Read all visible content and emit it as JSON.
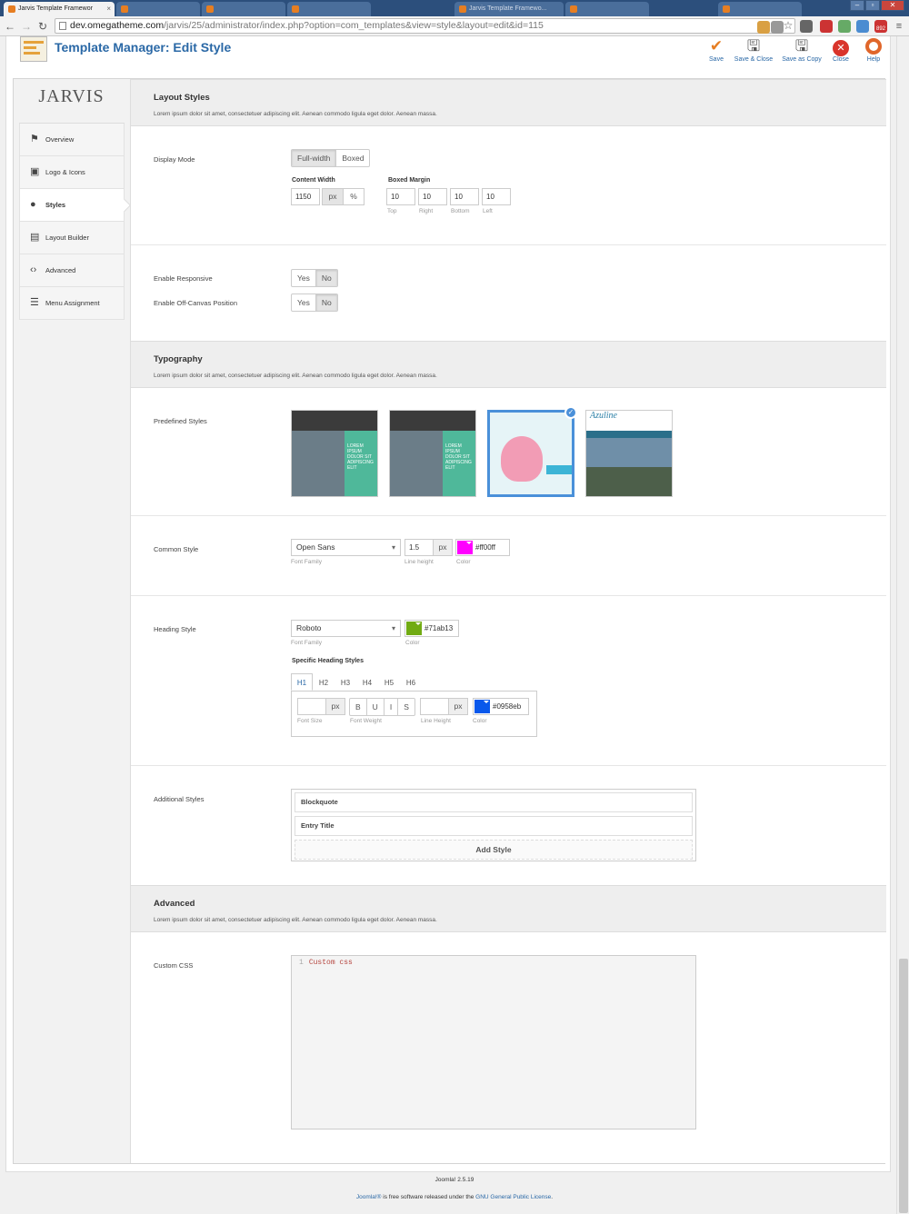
{
  "browser": {
    "tabs": [
      {
        "label": "Jarvis Template Framewor",
        "active": true
      },
      {
        "label": "",
        "active": false
      },
      {
        "label": "",
        "active": false
      },
      {
        "label": "",
        "active": false
      },
      {
        "label": "Jarvis Template Framewo...",
        "active": false
      },
      {
        "label": "",
        "active": false
      },
      {
        "label": "",
        "active": false
      }
    ],
    "url_host": "dev.omegatheme.com",
    "url_path": "/jarvis/25/administrator/index.php?option=com_templates&view=style&layout=edit&id=115",
    "badge": "892"
  },
  "toolbar": {
    "title": "Template Manager: Edit Style",
    "buttons": [
      {
        "label": "Save",
        "icon": "check-icon",
        "color": "#e67e22"
      },
      {
        "label": "Save & Close",
        "icon": "save-icon",
        "color": "#555555"
      },
      {
        "label": "Save as Copy",
        "icon": "save-copy-icon",
        "color": "#555555"
      },
      {
        "label": "Close",
        "icon": "close-icon",
        "color": "#d9342b"
      },
      {
        "label": "Help",
        "icon": "help-icon",
        "color": "#e0662a"
      }
    ]
  },
  "sidebar": {
    "logo": "JARVIS",
    "items": [
      {
        "label": "Overview",
        "icon": "flag-icon"
      },
      {
        "label": "Logo & Icons",
        "icon": "image-icon"
      },
      {
        "label": "Styles",
        "icon": "palette-icon",
        "active": true
      },
      {
        "label": "Layout Builder",
        "icon": "layout-icon"
      },
      {
        "label": "Advanced",
        "icon": "code-icon"
      },
      {
        "label": "Menu Assignment",
        "icon": "menu-icon"
      }
    ]
  },
  "layout": {
    "title": "Layout Styles",
    "desc": "Lorem ipsum dolor sit amet, consectetuer adipiscing elit. Aenean commodo ligula eget dolor. Aenean massa.",
    "display_mode_label": "Display Mode",
    "modes": [
      "Full-width",
      "Boxed"
    ],
    "content_width_label": "Content Width",
    "content_width": "1150",
    "units": [
      "px",
      "%"
    ],
    "boxed_margin_label": "Boxed Margin",
    "margins": [
      {
        "value": "10",
        "label": "Top"
      },
      {
        "value": "10",
        "label": "Right"
      },
      {
        "value": "10",
        "label": "Bottom"
      },
      {
        "value": "10",
        "label": "Left"
      }
    ],
    "responsive_label": "Enable Responsive",
    "offcanvas_label": "Enable Off-Canvas Position",
    "yes": "Yes",
    "no": "No"
  },
  "typography": {
    "title": "Typography",
    "desc": "Lorem ipsum dolor sit amet, consectetuer adipiscing elit. Aenean commodo ligula eget dolor. Aenean massa.",
    "predefined_label": "Predefined Styles",
    "thumb_texts": [
      "LOREM IPSUM DOLOR SIT ADIPISCING ELIT",
      "LOREM IPSUM DOLOR SIT ADIPISCING ELIT",
      "",
      "Azuline"
    ],
    "thumb_check": "✓",
    "common_label": "Common Style",
    "common_font": "Open Sans",
    "line_height": "1.5",
    "px": "px",
    "font_family_sub": "Font Family",
    "line_height_sub": "Line height",
    "color_sub": "Color",
    "common_color": "#ff00ff",
    "heading_label": "Heading Style",
    "heading_font": "Roboto",
    "heading_color": "#71ab13",
    "specific_label": "Specific Heading Styles",
    "htabs": [
      "H1",
      "H2",
      "H3",
      "H4",
      "H5",
      "H6"
    ],
    "weights": [
      "B",
      "U",
      "I",
      "S"
    ],
    "font_size_sub": "Font Size",
    "font_weight_sub": "Font Weight",
    "line_height_sub2": "Line Height",
    "h_color": "#0958eb",
    "additional_label": "Additional Styles",
    "additional_items": [
      "Blockquote",
      "Entry Title"
    ],
    "add_style": "Add Style"
  },
  "advanced": {
    "title": "Advanced",
    "desc": "Lorem ipsum dolor sit amet, consectetuer adipiscing elit. Aenean commodo ligula eget dolor. Aenean massa.",
    "css_label": "Custom CSS",
    "line_no": "1",
    "css_text": "Custom css"
  },
  "footer": {
    "version": "Joomla! 2.5.19",
    "joomla": "Joomla!®",
    "text": " is free software released under the ",
    "license": "GNU General Public License",
    "end": "."
  }
}
